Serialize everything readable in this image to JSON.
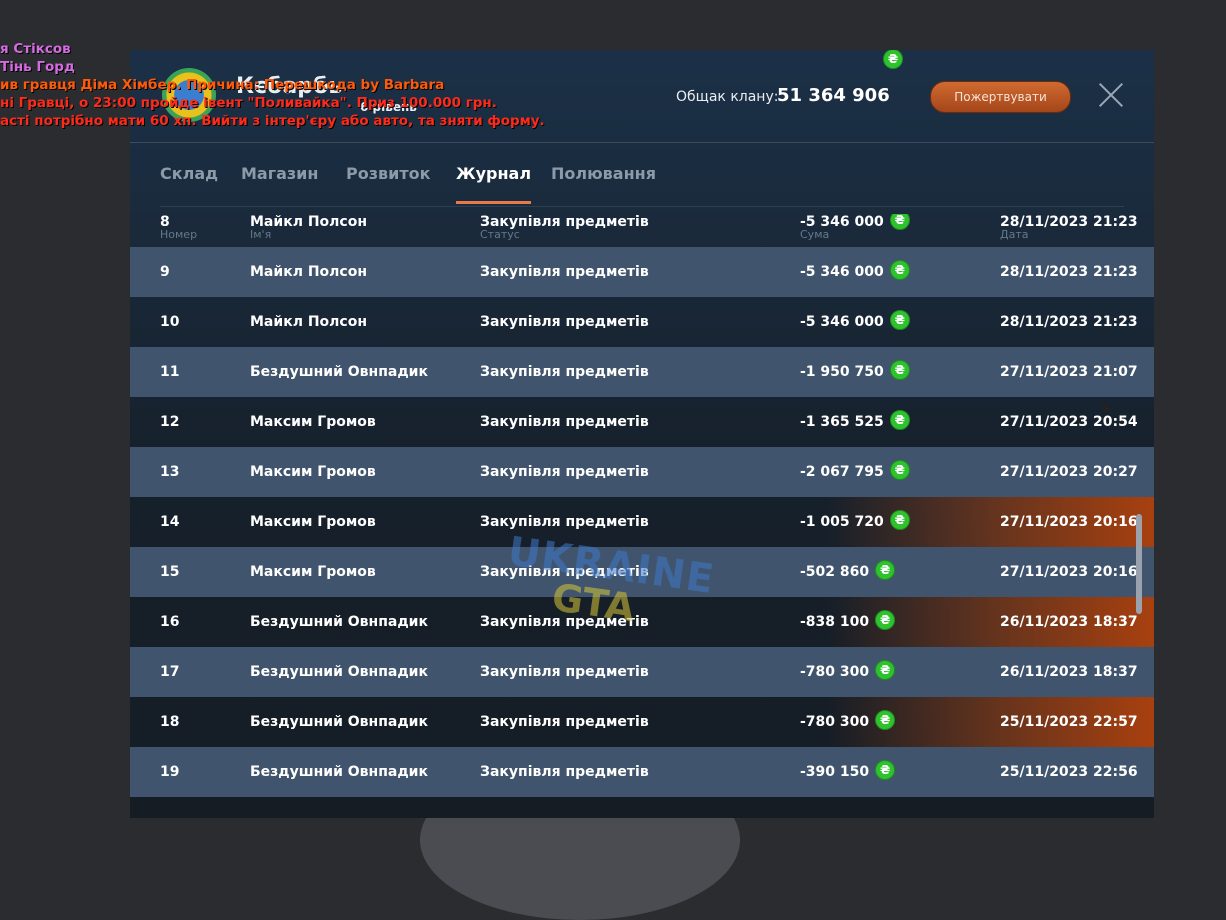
{
  "chat": {
    "lines": [
      {
        "text": "я Стіксов",
        "color": "purple"
      },
      {
        "text": "Тінь Горд",
        "color": "purple"
      },
      {
        "text": "ив гравця Діма Хімбер. Причина: Перешкода by Barbara",
        "color": "orange"
      },
      {
        "text": "ні Гравці, о 23:00 пройде івент \"Поливайка\". Приз 100.000 грн.",
        "color": "red"
      },
      {
        "text": "асті потрібно мати 60 хп. Вийти з інтер'єру або авто, та зняти форму.",
        "color": "red"
      }
    ]
  },
  "header": {
    "clan_name": "Кєбарбь",
    "clan_level": "6 рівень",
    "fund_label": "Общак клану:",
    "fund_value": "51 364 906",
    "donate_label": "Пожертвувати"
  },
  "tabs": [
    {
      "label": "Склад",
      "active": false
    },
    {
      "label": "Магазин",
      "active": false
    },
    {
      "label": "Розвиток",
      "active": false
    },
    {
      "label": "Журнал",
      "active": true
    },
    {
      "label": "Полювання",
      "active": false
    }
  ],
  "table": {
    "headers": {
      "num": "Номер",
      "name": "Ім'я",
      "status": "Статус",
      "sum": "Сума",
      "date": "Дата"
    },
    "rows": [
      {
        "num": "8",
        "name": "Майкл Полсон",
        "status": "Закупівля предметів",
        "sum": "-5 346 000",
        "date": "28/11/2023 21:23"
      },
      {
        "num": "9",
        "name": "Майкл Полсон",
        "status": "Закупівля предметів",
        "sum": "-5 346 000",
        "date": "28/11/2023 21:23"
      },
      {
        "num": "10",
        "name": "Майкл Полсон",
        "status": "Закупівля предметів",
        "sum": "-5 346 000",
        "date": "28/11/2023 21:23"
      },
      {
        "num": "11",
        "name": "Бездушний Овнпадик",
        "status": "Закупівля предметів",
        "sum": "-1 950 750",
        "date": "27/11/2023 21:07"
      },
      {
        "num": "12",
        "name": "Максим Громов",
        "status": "Закупівля предметів",
        "sum": "-1 365 525",
        "date": "27/11/2023 20:54"
      },
      {
        "num": "13",
        "name": "Максим Громов",
        "status": "Закупівля предметів",
        "sum": "-2 067 795",
        "date": "27/11/2023 20:27"
      },
      {
        "num": "14",
        "name": "Максим Громов",
        "status": "Закупівля предметів",
        "sum": "-1 005 720",
        "date": "27/11/2023 20:16"
      },
      {
        "num": "15",
        "name": "Максим Громов",
        "status": "Закупівля предметів",
        "sum": "-502 860",
        "date": "27/11/2023 20:16"
      },
      {
        "num": "16",
        "name": "Бездушний Овнпадик",
        "status": "Закупівля предметів",
        "sum": "-838 100",
        "date": "26/11/2023 18:37"
      },
      {
        "num": "17",
        "name": "Бездушний Овнпадик",
        "status": "Закупівля предметів",
        "sum": "-780 300",
        "date": "26/11/2023 18:37"
      },
      {
        "num": "18",
        "name": "Бездушний Овнпадик",
        "status": "Закупівля предметів",
        "sum": "-780 300",
        "date": "25/11/2023 22:57"
      },
      {
        "num": "19",
        "name": "Бездушний Овнпадик",
        "status": "Закупівля предметів",
        "sum": "-390 150",
        "date": "25/11/2023 22:56"
      }
    ]
  },
  "watermark": {
    "line1": "UKRAINE",
    "line2": "GTA"
  },
  "currency_symbol": "₴",
  "colors": {
    "accent": "#e9794a",
    "coin": "#2fc22f",
    "row_light": "#40556d",
    "donate": "#c0592a"
  }
}
